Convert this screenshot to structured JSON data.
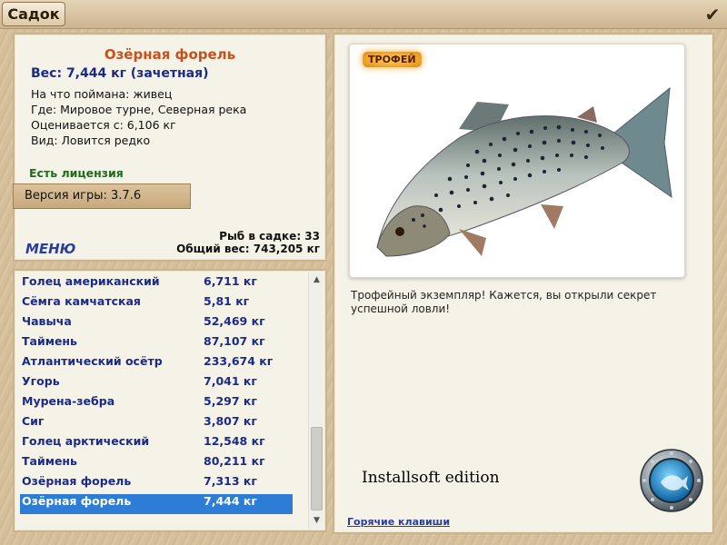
{
  "window": {
    "title": "Садок",
    "close_icon": "checkmark-icon"
  },
  "fish": {
    "name": "Озёрная форель",
    "weight_line": "Вес: 7,444 кг (зачетная)",
    "caught_with": "На что поймана: живец",
    "location": "Где: Мировое турне, Северная река",
    "rated_from": "Оценивается с: 6,106 кг",
    "kind": "Вид: Ловится редко"
  },
  "license": "Есть лицензия",
  "version": "Версия игры:   3.7.6",
  "menu_label": "МЕНЮ",
  "stats": {
    "count_line": "Рыб в садке: 33",
    "total_line": "Общий вес: 743,205 кг"
  },
  "catch_list": [
    {
      "name": "Голец американский",
      "weight": "6,711 кг"
    },
    {
      "name": "Сёмга камчатская",
      "weight": "5,81 кг"
    },
    {
      "name": "Чавыча",
      "weight": "52,469 кг"
    },
    {
      "name": "Таймень",
      "weight": "87,107 кг"
    },
    {
      "name": "Атлантический осётр",
      "weight": "233,674 кг"
    },
    {
      "name": "Угорь",
      "weight": "7,041 кг"
    },
    {
      "name": "Мурена-зебра",
      "weight": "5,297 кг"
    },
    {
      "name": "Сиг",
      "weight": "3,807 кг"
    },
    {
      "name": "Голец арктический",
      "weight": "12,548 кг"
    },
    {
      "name": "Таймень",
      "weight": "80,211 кг"
    },
    {
      "name": "Озёрная форель",
      "weight": "7,313 кг"
    },
    {
      "name": "Озёрная форель",
      "weight": "7,444 кг",
      "selected": true
    }
  ],
  "right": {
    "trophy_badge": "ТРОФЕЙ",
    "trophy_text": "Трофейный экземпляр! Кажется, вы открыли секрет успешной ловли!",
    "watermark": "Installsoft edition",
    "hotkeys_link": "Горячие клавиши"
  },
  "colors": {
    "fish_name": "#c8501a",
    "weight": "#1a2a8a",
    "license": "#1f6a1f",
    "selected_row": "#2d7dd6"
  }
}
